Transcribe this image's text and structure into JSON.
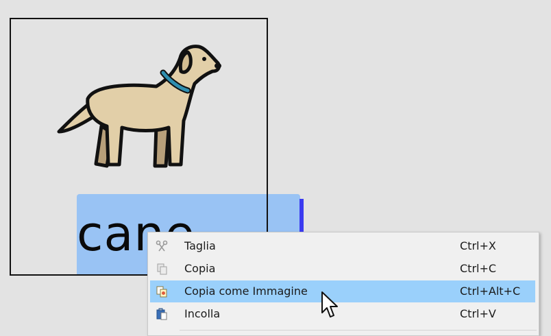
{
  "symbol": {
    "word": "cane",
    "image_icon": "dog-icon"
  },
  "context_menu": {
    "items": [
      {
        "label": "Taglia",
        "shortcut": "Ctrl+X",
        "icon": "scissors-icon",
        "enabled": false
      },
      {
        "label": "Copia",
        "shortcut": "Ctrl+C",
        "icon": "copy-icon",
        "enabled": false
      },
      {
        "label": "Copia come Immagine",
        "shortcut": "Ctrl+Alt+C",
        "icon": "copy-image-icon",
        "enabled": true,
        "highlighted": true
      },
      {
        "label": "Incolla",
        "shortcut": "Ctrl+V",
        "icon": "paste-icon",
        "enabled": true
      }
    ]
  },
  "colors": {
    "highlight": "#9ad0fb",
    "text_selection": "#99c3f4",
    "caret": "#3b3bf0",
    "dog_body": "#e2cfa8",
    "dog_collar": "#2f8fb0"
  }
}
